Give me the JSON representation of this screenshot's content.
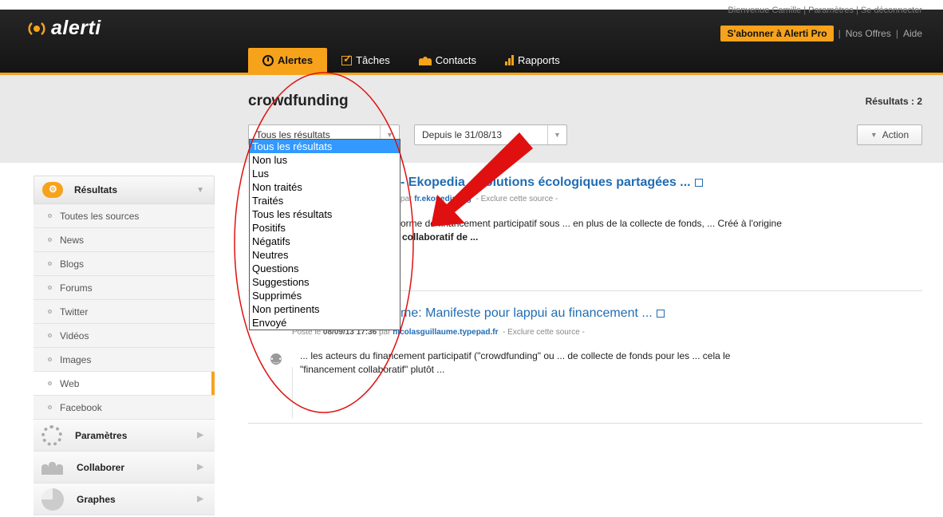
{
  "header": {
    "logo": "alerti",
    "welcome": "Bienvenue Camille  |  Paramètres  |  Se déconnecter",
    "pro_button": "S'abonner à Alerti Pro",
    "links": [
      "Nos Offres",
      "Aide"
    ],
    "tabs": [
      {
        "label": "Alertes",
        "icon": "clock-icon",
        "active": true
      },
      {
        "label": "Tâches",
        "icon": "checkbox-icon",
        "active": false
      },
      {
        "label": "Contacts",
        "icon": "people-icon",
        "active": false
      },
      {
        "label": "Rapports",
        "icon": "bar-chart-icon",
        "active": false
      }
    ]
  },
  "toolbar": {
    "query": "crowdfunding",
    "results_count": "Résultats : 2",
    "filter_select": {
      "value": "Tous les résultats"
    },
    "date_select": {
      "value": "Depuis le 31/08/13"
    },
    "action_label": "Action"
  },
  "dropdown": {
    "options": [
      "Tous les résultats",
      "Non lus",
      "Lus",
      "Non traités",
      "Traités",
      "Tous les résultats",
      "Positifs",
      "Négatifs",
      "Neutres",
      "Questions",
      "Suggestions",
      "Supprimés",
      "Non pertinents",
      "Envoyé"
    ],
    "selected_index": 0
  },
  "sidebar": {
    "header": "Résultats",
    "items": [
      "Toutes les sources",
      "News",
      "Blogs",
      "Forums",
      "Twitter",
      "Vidéos",
      "Images",
      "Web",
      "Facebook"
    ],
    "active_item": "Web",
    "sections": [
      "Paramètres",
      "Collaborer",
      "Graphes"
    ]
  },
  "results": [
    {
      "title": "- Ekopedia - Solutions écologiques partagées ...",
      "meta_by": "par",
      "source": "fr.ekopedia.org",
      "exclude": "- Exclure cette source -",
      "snippet_line1": "eforme de financement participatif sous ... en plus de la collecte de fonds, ... Créé à l'origine",
      "snippet_line2": "collaboratif de ..."
    },
    {
      "title": "me: Manifeste pour lappui au financement ...",
      "meta_prefix": "Posté le",
      "date": "08/09/13 17:36",
      "meta_by": "par",
      "source": "nicolasguillaume.typepad.fr",
      "exclude": "- Exclure cette source -",
      "snippet_line1": "... les acteurs du financement participatif (\"crowdfunding\" ou ... de collecte de fonds pour les ... cela le",
      "snippet_line2": "\"financement collaboratif\" plutôt ..."
    }
  ],
  "colors": {
    "accent": "#f7a21b",
    "link": "#1f6db4",
    "annotation": "#e01010"
  }
}
